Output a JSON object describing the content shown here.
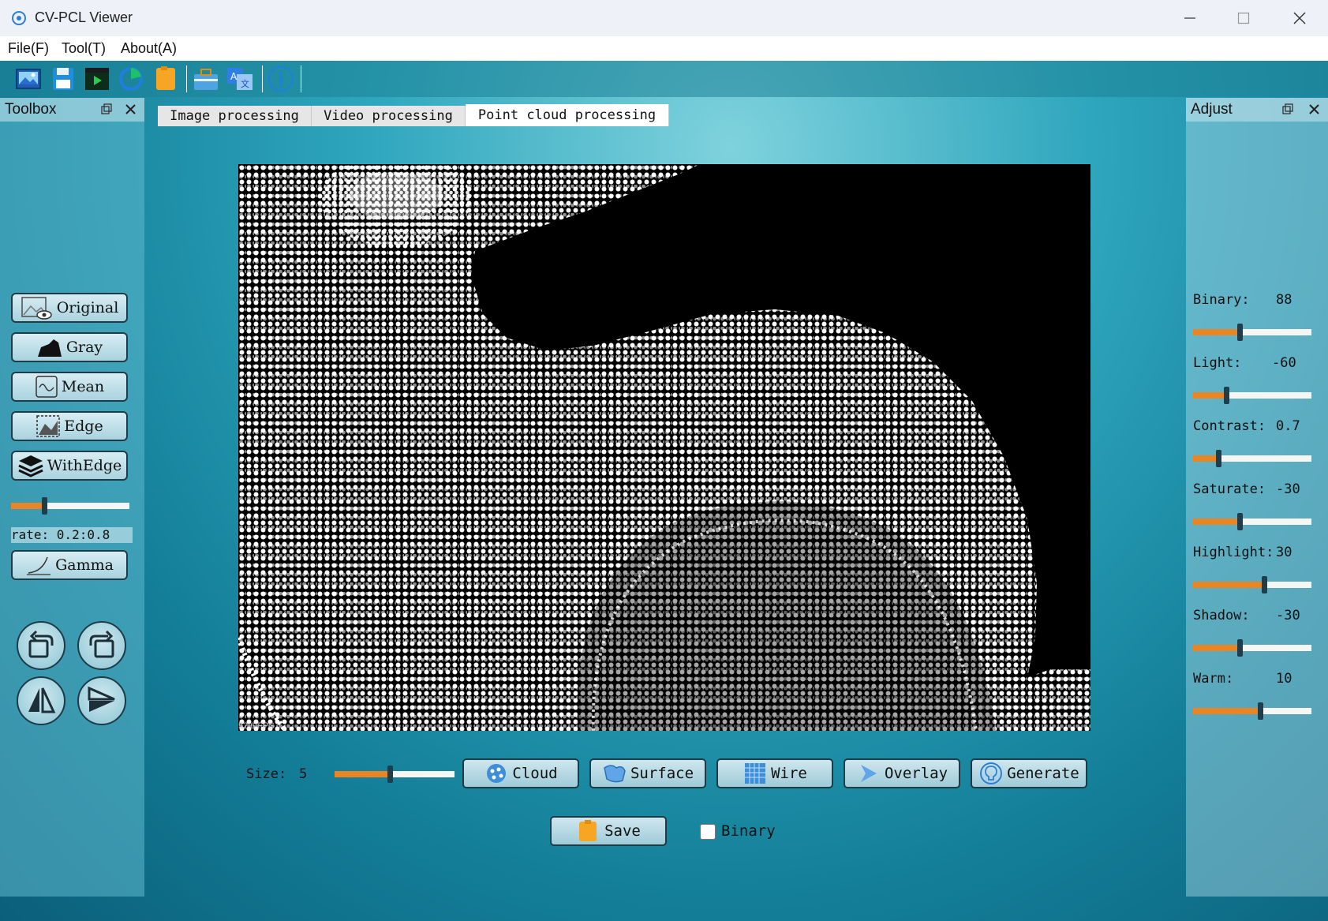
{
  "window": {
    "title": "CV-PCL Viewer"
  },
  "menu": {
    "file": "File(F)",
    "tool": "Tool(T)",
    "about": "About(A)"
  },
  "toolbox": {
    "title": "Toolbox",
    "buttons": {
      "original": "Original",
      "gray": "Gray",
      "mean": "Mean",
      "edge": "Edge",
      "with_edge": "WithEdge",
      "gamma": "Gamma"
    },
    "rate_label": "rate: 0.2:0.8",
    "rate_slider_fraction": 0.28
  },
  "tabs": [
    {
      "label": "Image processing"
    },
    {
      "label": "Video processing"
    },
    {
      "label": "Point cloud processing",
      "active": true
    }
  ],
  "viewport": {
    "fps": "52.6 FPS"
  },
  "controls": {
    "size_label": "Size:",
    "size_value": "5",
    "size_slider_fraction": 0.46,
    "buttons": {
      "cloud": "Cloud",
      "surface": "Surface",
      "wire": "Wire",
      "overlay": "Overlay",
      "generate": "Generate"
    },
    "save": "Save",
    "binary_checkbox": "Binary",
    "binary_checked": false
  },
  "adjust": {
    "title": "Adjust",
    "items": [
      {
        "label": "Binary:",
        "value": "88",
        "fraction": 0.39
      },
      {
        "label": "Light:",
        "value": "-60",
        "fraction": 0.28
      },
      {
        "label": "Contrast:",
        "value": "0.7",
        "fraction": 0.21
      },
      {
        "label": "Saturate:",
        "value": "-30",
        "fraction": 0.39
      },
      {
        "label": "Highlight:",
        "value": "30",
        "fraction": 0.6
      },
      {
        "label": "Shadow:",
        "value": "-30",
        "fraction": 0.39
      },
      {
        "label": "Warm:",
        "value": "10",
        "fraction": 0.57
      }
    ]
  },
  "colors": {
    "accent": "#e98524",
    "border": "#1e3b48",
    "background": "#1a8fa6"
  }
}
